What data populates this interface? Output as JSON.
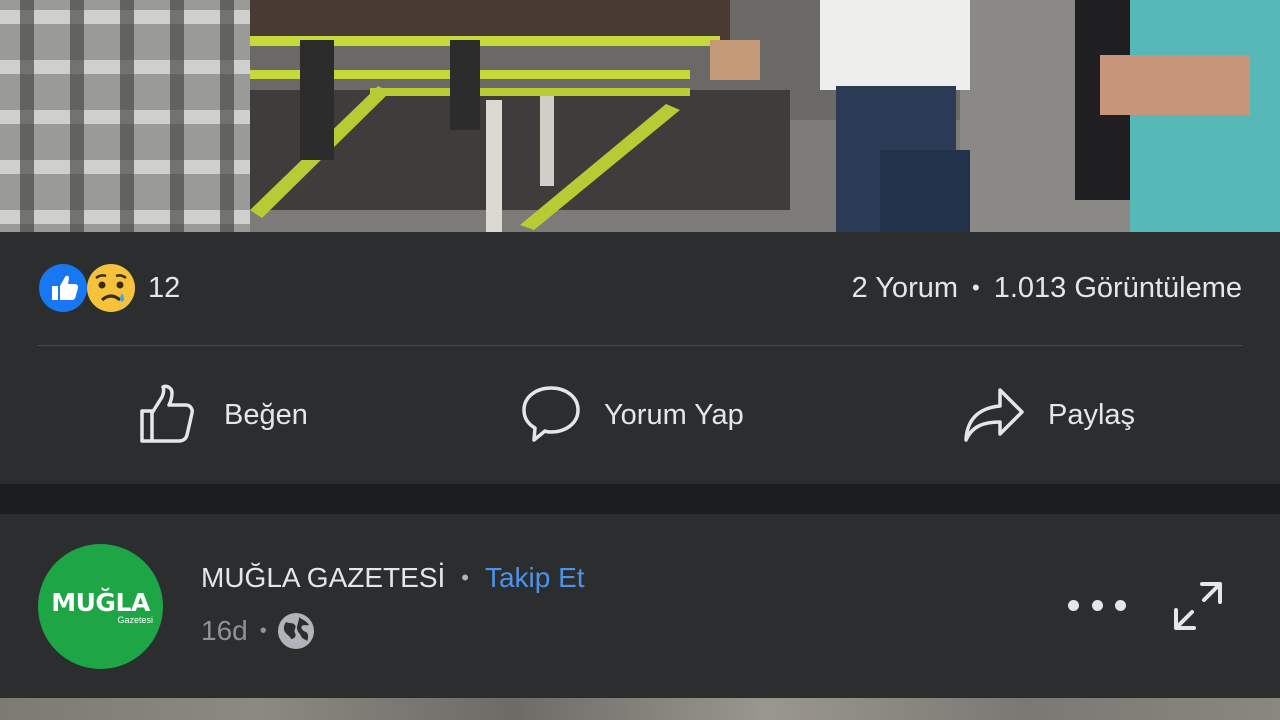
{
  "post": {
    "reaction_count": "12",
    "comments": "2 Yorum",
    "stats_separator": "•",
    "views": "1.013 Görüntüleme",
    "actions": {
      "like": "Beğen",
      "comment": "Yorum Yap",
      "share": "Paylaş"
    },
    "reaction_icons": [
      "like-reaction-icon",
      "sad-reaction-icon"
    ]
  },
  "next_post": {
    "page_name": "MUĞLA GAZETESİ",
    "separator": "•",
    "follow_label": "Takip Et",
    "time": "16d",
    "avatar": {
      "text": "MUĞLA",
      "subtext": "Gazetesi",
      "color": "#1ea646"
    },
    "privacy_icon": "globe-icon",
    "menu_icon": "more-horizontal-icon",
    "expand_icon": "expand-icon"
  },
  "colors": {
    "background": "#242526",
    "card": "#2c2d2f",
    "text": "#e4e6eb",
    "secondary_text": "#8e9196",
    "link": "#4b94e8",
    "like_blue": "#1877f2"
  }
}
